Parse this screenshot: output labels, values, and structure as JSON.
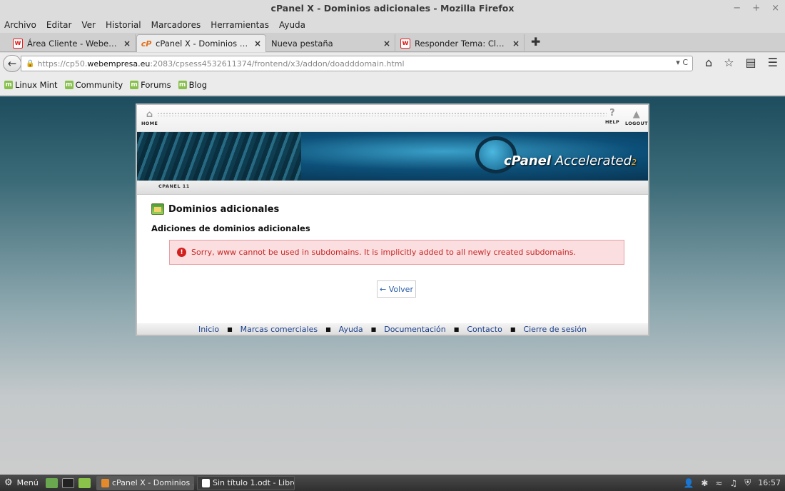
{
  "window": {
    "title": "cPanel X - Dominios adicionales - Mozilla Firefox",
    "controls": [
      "−",
      "+",
      "×"
    ]
  },
  "menu": [
    "Archivo",
    "Editar",
    "Ver",
    "Historial",
    "Marcadores",
    "Herramientas",
    "Ayuda"
  ],
  "tabs": [
    {
      "title": "Área Cliente - Webempre...",
      "favicon": "w",
      "active": false
    },
    {
      "title": "cPanel X - Dominios adici...",
      "favicon": "cP",
      "active": true
    },
    {
      "title": "Nueva pestaña",
      "favicon": "",
      "active": false
    },
    {
      "title": "Responder Tema: Clonar ...",
      "favicon": "w",
      "active": false
    }
  ],
  "tab_close": "×",
  "new_tab": "✚",
  "url": {
    "prefix": "https://cp50.",
    "domain": "webempresa.eu",
    "rest": ":2083/cpsess4532611374/frontend/x3/addon/doadddomain.html",
    "right_icons": "▾ C"
  },
  "bookmarks": [
    "Linux Mint",
    "Community",
    "Forums",
    "Blog"
  ],
  "cpanel": {
    "home": "HOME",
    "help": "HELP",
    "logout": "LOGOUT",
    "brand_c": "cPanel",
    "brand_acc": "Accelerated",
    "brand_2": "2",
    "version": "CPANEL 11",
    "heading": "Dominios adicionales",
    "subheading": "Adiciones de dominios adicionales",
    "error": "Sorry, www cannot be used in subdomains. It is implicitly added to all newly created subdomains.",
    "back_button": "← Volver",
    "footer_links": [
      "Inicio",
      "Marcas comerciales",
      "Ayuda",
      "Documentación",
      "Contacto",
      "Cierre de sesión"
    ]
  },
  "taskbar": {
    "menu": "Menú",
    "tasks": [
      {
        "title": "cPanel X - Dominios ...",
        "active": true
      },
      {
        "title": "Sin título 1.odt - Libre...",
        "active": false
      }
    ],
    "clock": "16:57"
  },
  "colors": {
    "error_bg": "#fbdedf",
    "error_text": "#c62828",
    "link": "#1a3f8b",
    "page_bg_top": "#1d4d5e"
  }
}
